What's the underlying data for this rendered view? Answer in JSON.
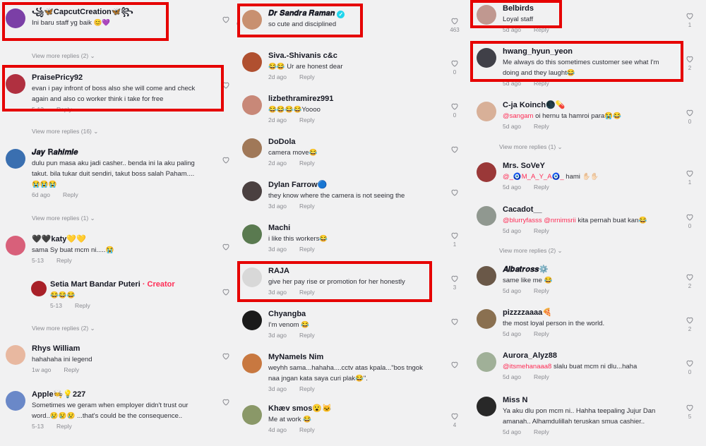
{
  "col1": [
    {
      "name": "꧁🦋CapcutCreation🦋꧂",
      "text": "Ini baru staff yg baik 😊💜",
      "date": "",
      "reply": "",
      "likes": "",
      "av": "#7b3fa6"
    },
    {
      "name": "PraisePricy92",
      "text": "evan i pay infront of boss also she will come and check again and also co worker think i take for free",
      "date": "5-13",
      "reply": "Reply",
      "likes": "",
      "av": "#b03040"
    },
    {
      "name": "𝑱𝒂𝒚 ℝ𝒂𝒉𝒊𝒎𝒊𝒆",
      "text": "dulu pun masa aku jadi casher.. benda ini la aku paling takut. bila tukar duit sendiri, takut boss salah Paham.... 😭😭😭",
      "date": "6d ago",
      "reply": "Reply",
      "likes": "",
      "av": "#3a6fb0"
    },
    {
      "name": "🖤🖤katy💛💛",
      "text": "sama Sy buat mcm ni.....😭",
      "date": "5-13",
      "reply": "Reply",
      "likes": "",
      "av": "#d8607a"
    },
    {
      "name": "Setia Mart Bandar Puteri",
      "creator": "· Creator",
      "text": "😂😂😂",
      "date": "5-13",
      "reply": "Reply",
      "likes": "",
      "av": "#a82028"
    },
    {
      "name": "Rhys William",
      "text": "hahahaha ini legend",
      "date": "1w ago",
      "reply": "Reply",
      "likes": "",
      "av": "#e8b8a0"
    },
    {
      "name": "Apple🧑‍🍳💡227",
      "text": "Sometimes we geram when employer didn't trust our word..😢😢😢 ...that's could be the consequence..",
      "date": "5-13",
      "reply": "Reply",
      "likes": "",
      "av": "#6a88c8"
    }
  ],
  "col1_more": [
    "View more replies (2)",
    "View more replies (16)",
    "View more replies (1)",
    "View more replies (2)"
  ],
  "col2": [
    {
      "name": "𝑫𝒓 𝑺𝒂𝒏𝒅𝒓𝒂 𝑹𝒂𝒎𝒂𝒏",
      "verified": "✓",
      "text": "so cute and disciplined",
      "date": "",
      "reply": "",
      "likes": "463",
      "av": "#c89070"
    },
    {
      "name": "Siva.-Shivanis c&c",
      "text": "😂😂 Ur are honest dear",
      "date": "2d ago",
      "reply": "Reply",
      "likes": "0",
      "av": "#b05030"
    },
    {
      "name": "lizbethramirez991",
      "text": "😂😂😂😂Yoooo",
      "date": "2d ago",
      "reply": "Reply",
      "likes": "0",
      "av": "#c88878"
    },
    {
      "name": "DoDola",
      "text": "camera move😂",
      "date": "2d ago",
      "reply": "Reply",
      "likes": "",
      "av": "#a07858"
    },
    {
      "name": "Dylan Farrow🔵",
      "text": "they know where the camera is not seeing the",
      "date": "3d ago",
      "reply": "Reply",
      "likes": "",
      "av": "#4a4040"
    },
    {
      "name": "Machi",
      "text": "i like this workers😂",
      "date": "3d ago",
      "reply": "Reply",
      "likes": "1",
      "av": "#5a7a50"
    },
    {
      "name": "RAJA",
      "text": "give her pay rise or promotion for her honestly",
      "date": "3d ago",
      "reply": "Reply",
      "likes": "3",
      "av": "#d8d8d8"
    },
    {
      "name": "Chyangba",
      "text": "I'm venom 😂",
      "date": "3d ago",
      "reply": "Reply",
      "likes": "",
      "av": "#1a1a1a"
    },
    {
      "name": "MyNameIs Nim",
      "text": "weyhh sama...hahaha....cctv atas kpala...\"bos tngok naa jngan kata saya curi plak😂\".",
      "date": "3d ago",
      "reply": "Reply",
      "likes": "",
      "av": "#c87840"
    },
    {
      "name": "Khæv smos😮🐱",
      "text": "Me at work 😂",
      "date": "4d ago",
      "reply": "Reply",
      "likes": "4",
      "av": "#8a9868"
    }
  ],
  "col3": [
    {
      "name": "Belbirds",
      "text": "Loyal staff",
      "date": "5d ago",
      "reply": "Reply",
      "likes": "1",
      "av": "#c09890"
    },
    {
      "name": "hwang_hyun_yeon",
      "text": "Me always do this sometimes customer see what I'm doing and they laught😂",
      "date": "5d ago",
      "reply": "Reply",
      "likes": "2",
      "av": "#404048"
    },
    {
      "name": "C-ja Koinch🌑💊",
      "text": "@sangam oi hernu ta hamroi para😭😂",
      "mention": "@sangam",
      "date": "5d ago",
      "reply": "Reply",
      "likes": "0",
      "av": "#d8b098"
    },
    {
      "name": "Mrs. SoVeY",
      "text": "@_🧿M_A_Y_A🧿_ hami ✋🏻✋🏻",
      "mention": "@_🧿M_A_Y_A🧿_",
      "date": "5d ago",
      "reply": "Reply",
      "likes": "1",
      "av": "#9a3838"
    },
    {
      "name": "Cacadot__",
      "text": "@blurryfasss @nrnimsrii kita pernah buat kan😂",
      "mention": "@blurryfasss @nrnimsrii",
      "date": "5d ago",
      "reply": "Reply",
      "likes": "0",
      "av": "#909890"
    },
    {
      "name": "𝑨𝒍𝒃𝒂𝒕𝒓𝒐𝒔𝒔⚙️",
      "text": "same like me 😂",
      "date": "5d ago",
      "reply": "Reply",
      "likes": "2",
      "av": "#6a5848"
    },
    {
      "name": "pizzzzaaaa🍕",
      "text": "the most loyal person in the world.",
      "date": "5d ago",
      "reply": "Reply",
      "likes": "2",
      "av": "#8a7050"
    },
    {
      "name": "Aurora_Alyz88",
      "text": "@itsmehanaaa8 slalu buat mcm ni dlu...haha",
      "mention": "@itsmehanaaa8",
      "date": "5d ago",
      "reply": "Reply",
      "likes": "0",
      "av": "#a0b098"
    },
    {
      "name": "Miss N",
      "text": "Ya aku dlu pon mcm ni.. Hahha teepaling Jujur Dan amanah.. Alhamdulillah teruskan smua cashier..",
      "date": "5d ago",
      "reply": "Reply",
      "likes": "5",
      "av": "#282828"
    }
  ],
  "col3_more": [
    "View more replies (1)",
    "View more replies (2)"
  ],
  "edge_likes": [
    "0",
    "0",
    "0",
    "0"
  ]
}
